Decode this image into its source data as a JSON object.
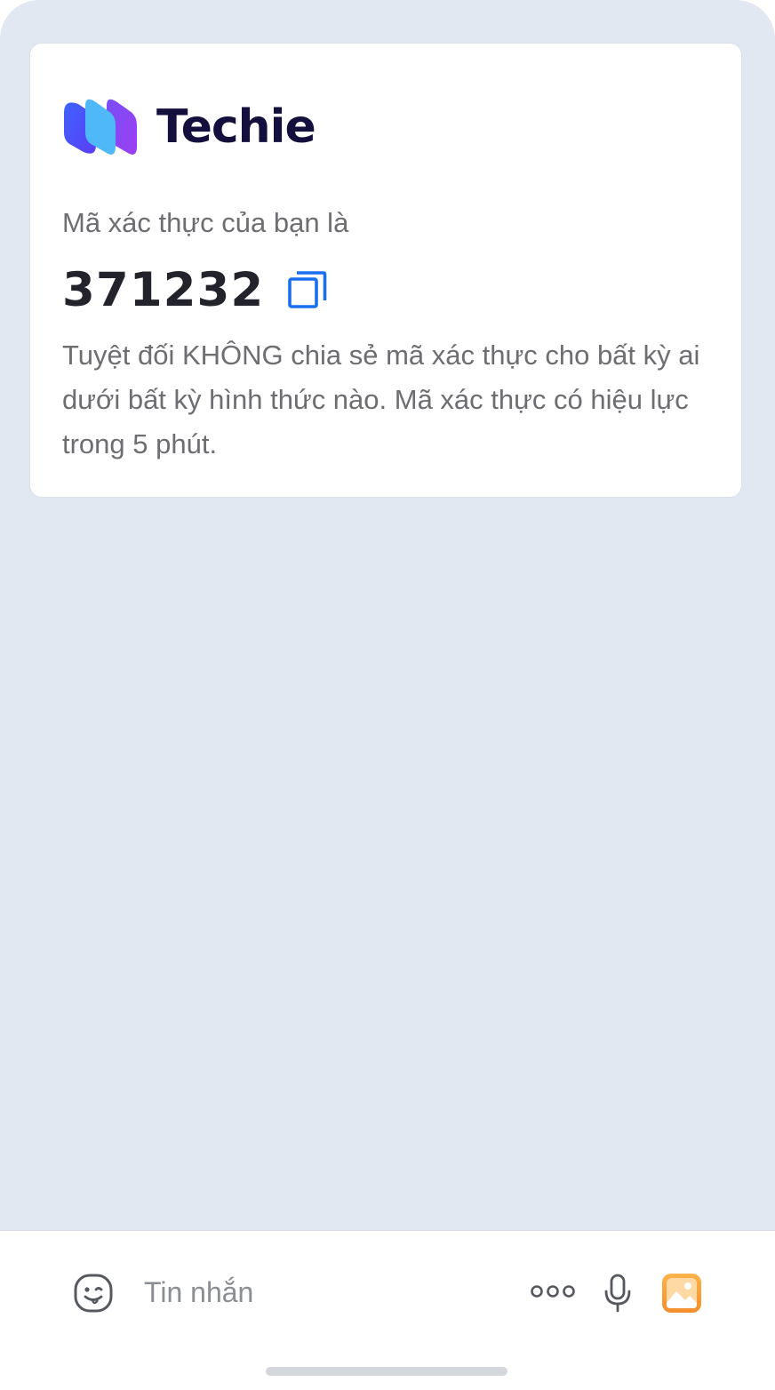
{
  "card": {
    "brand": {
      "name": "Techie",
      "logo_icon": "techie-logo-icon"
    },
    "intro_text": "Mã xác thực của bạn là",
    "otp_code": "371232",
    "copy_icon": "copy-icon",
    "warning_text": "Tuyệt đối KHÔNG chia sẻ mã xác thực cho bất kỳ ai dưới bất kỳ hình thức nào. Mã xác thực có hiệu lực trong 5 phút."
  },
  "composer": {
    "emoji_icon": "emoji-icon",
    "message_placeholder": "Tin nhắn",
    "message_value": "",
    "more_icon": "more-dots-icon",
    "mic_icon": "microphone-icon",
    "image_icon": "image-icon"
  },
  "colors": {
    "chat_background": "#e1e8f1",
    "brand_text": "#14103d",
    "accent_blue": "#1a6ff0",
    "image_icon_orange": "#f7a33c"
  }
}
